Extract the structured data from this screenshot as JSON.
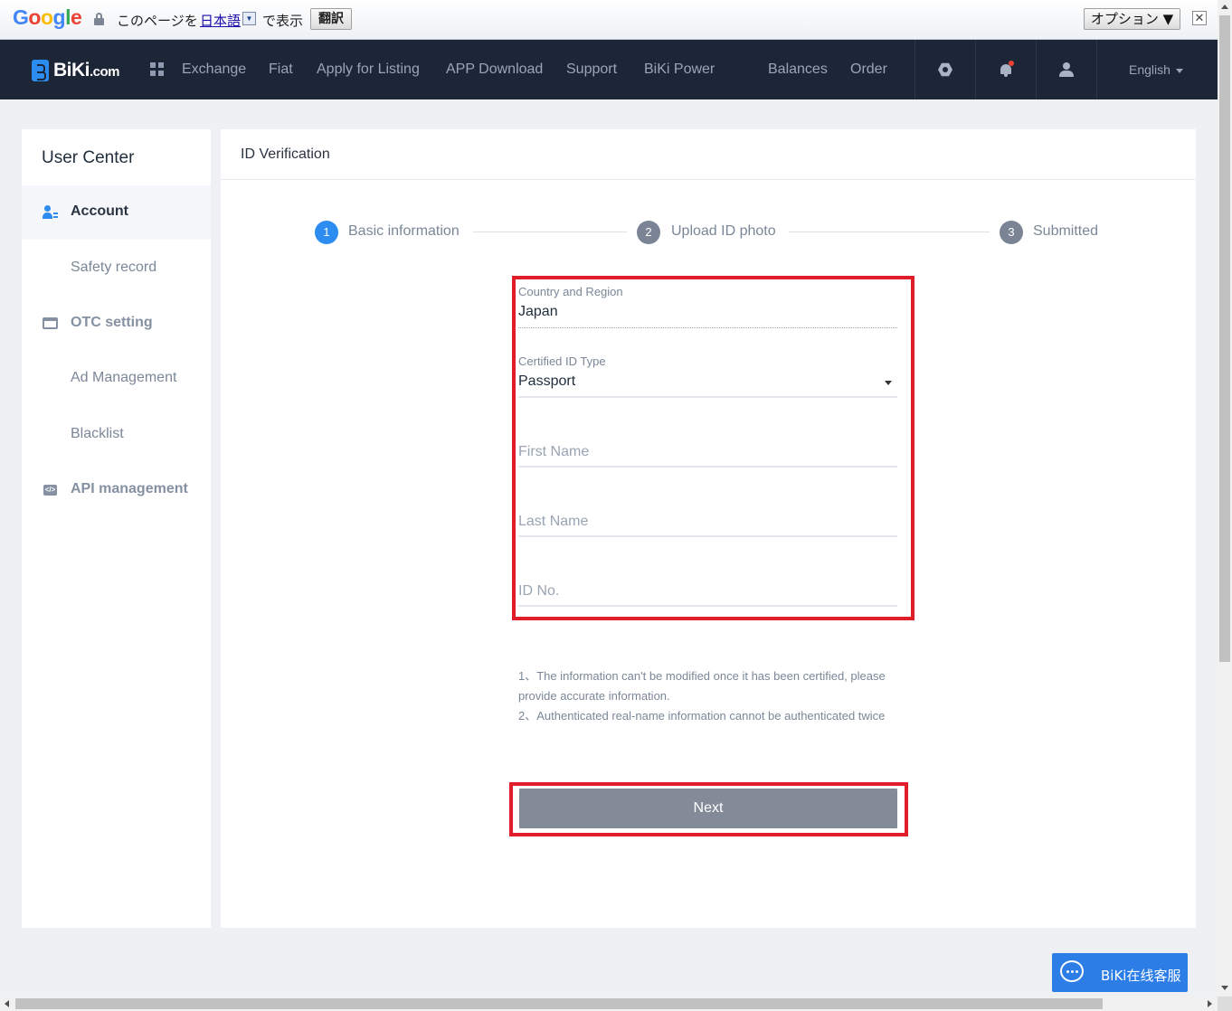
{
  "translate_bar": {
    "logo": "Google",
    "prefix": "このページを",
    "language": "日本語",
    "suffix": "で表示",
    "translate_button": "翻訳",
    "options_button": "オプション ▼",
    "close": "✕"
  },
  "nav": {
    "brand_main": "BiKi",
    "brand_suffix": ".com",
    "links": [
      "Exchange",
      "Fiat",
      "Apply for Listing",
      "APP Download",
      "Support",
      "BiKi Power"
    ],
    "right_links": [
      "Balances",
      "Order"
    ],
    "language": "English"
  },
  "sidebar": {
    "title": "User Center",
    "items": [
      {
        "label": "Account",
        "icon": "account-icon",
        "active": true
      },
      {
        "label": "Safety record"
      },
      {
        "label": "OTC setting",
        "icon": "card-icon"
      },
      {
        "label": "Ad Management"
      },
      {
        "label": "Blacklist"
      },
      {
        "label": "API management",
        "icon": "api-icon"
      }
    ]
  },
  "main": {
    "title": "ID Verification",
    "steps": [
      {
        "num": "1",
        "label": "Basic information",
        "active": true
      },
      {
        "num": "2",
        "label": "Upload ID photo",
        "active": false
      },
      {
        "num": "3",
        "label": "Submitted",
        "active": false
      }
    ],
    "form": {
      "country": {
        "label": "Country and Region",
        "value": "Japan"
      },
      "id_type": {
        "label": "Certified ID Type",
        "value": "Passport"
      },
      "first_name": {
        "placeholder": "First Name"
      },
      "last_name": {
        "placeholder": "Last Name"
      },
      "id_no": {
        "placeholder": "ID No."
      }
    },
    "notes": [
      "1、The information can't be modified once it has been certified, please provide accurate information.",
      "2、Authenticated real-name information cannot be authenticated twice"
    ],
    "next_button": "Next"
  },
  "chat": {
    "label": "BiKi在线客服"
  },
  "colors": {
    "accent": "#2d8cf0",
    "nav_bg": "#1c2637",
    "highlight_red": "#e21d2a",
    "button_gray": "#838b99"
  }
}
